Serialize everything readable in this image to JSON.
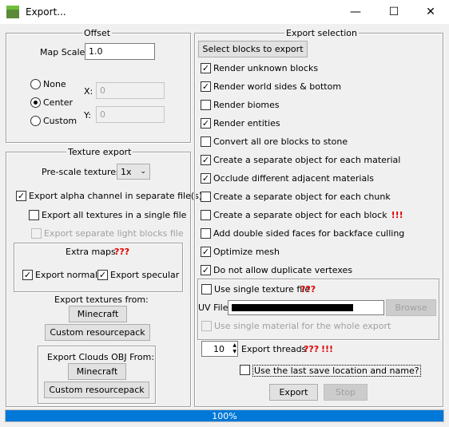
{
  "window": {
    "title": "Export...",
    "minimize": "—",
    "maximize": "☐",
    "close": "✕"
  },
  "offset": {
    "legend": "Offset",
    "map_scale_label": "Map Scale:",
    "map_scale_value": "1.0",
    "radio_none": "None",
    "radio_center": "Center",
    "radio_custom": "Custom",
    "x_label": "X:",
    "x_value": "0",
    "y_label": "Y:",
    "y_value": "0",
    "selected": "Center"
  },
  "texture": {
    "legend": "Texture export",
    "prescale_label": "Pre-scale textures:",
    "prescale_value": "1x",
    "alpha_label": "Export alpha channel in separate file(s)",
    "single_file_label": "Export all textures in a single file",
    "light_blocks_label": "Export separate light blocks file",
    "extra_maps_label": "Extra maps",
    "extra_maps_marks": "???",
    "normal_label": "Export normal",
    "specular_label": "Export specular",
    "from_label": "Export textures from:",
    "minecraft_button": "Minecraft",
    "custom_button": "Custom resourcepack",
    "clouds_label": "Export Clouds OBJ From:",
    "clouds_minecraft_button": "Minecraft",
    "clouds_custom_button": "Custom resourcepack"
  },
  "selection": {
    "legend": "Export selection",
    "select_blocks_button": "Select blocks to export",
    "options": [
      {
        "label": "Render unknown blocks",
        "checked": true,
        "mark": ""
      },
      {
        "label": "Render world sides & bottom",
        "checked": true,
        "mark": ""
      },
      {
        "label": "Render biomes",
        "checked": false,
        "mark": ""
      },
      {
        "label": "Render entities",
        "checked": true,
        "mark": ""
      },
      {
        "label": "Convert all ore blocks to stone",
        "checked": false,
        "mark": ""
      },
      {
        "label": "Create a separate object for each material",
        "checked": true,
        "mark": ""
      },
      {
        "label": "Occlude different adjacent materials",
        "checked": true,
        "mark": ""
      },
      {
        "label": "Create a separate object for each chunk",
        "checked": false,
        "mark": ""
      },
      {
        "label": "Create a separate object for each block",
        "checked": false,
        "mark": "!!!"
      },
      {
        "label": "Add double sided faces for backface culling",
        "checked": false,
        "mark": ""
      },
      {
        "label": "Optimize mesh",
        "checked": true,
        "mark": ""
      },
      {
        "label": "Do not allow duplicate vertexes",
        "checked": true,
        "mark": ""
      }
    ],
    "single_texture_label": "Use single texture file",
    "single_texture_marks": "???",
    "uv_file_label": "UV File:",
    "browse_button": "Browse",
    "single_material_label": "Use single material for the whole export",
    "threads_value": "10",
    "threads_label": "Export threads",
    "threads_marks_q": "???",
    "threads_marks_e": "!!!",
    "last_save_label": "Use the last save location and name?",
    "export_button": "Export",
    "stop_button": "Stop"
  },
  "progress": {
    "value": 1.0,
    "label": "100%"
  },
  "colors": {
    "accent": "#0078d7",
    "warning": "#e00000"
  }
}
